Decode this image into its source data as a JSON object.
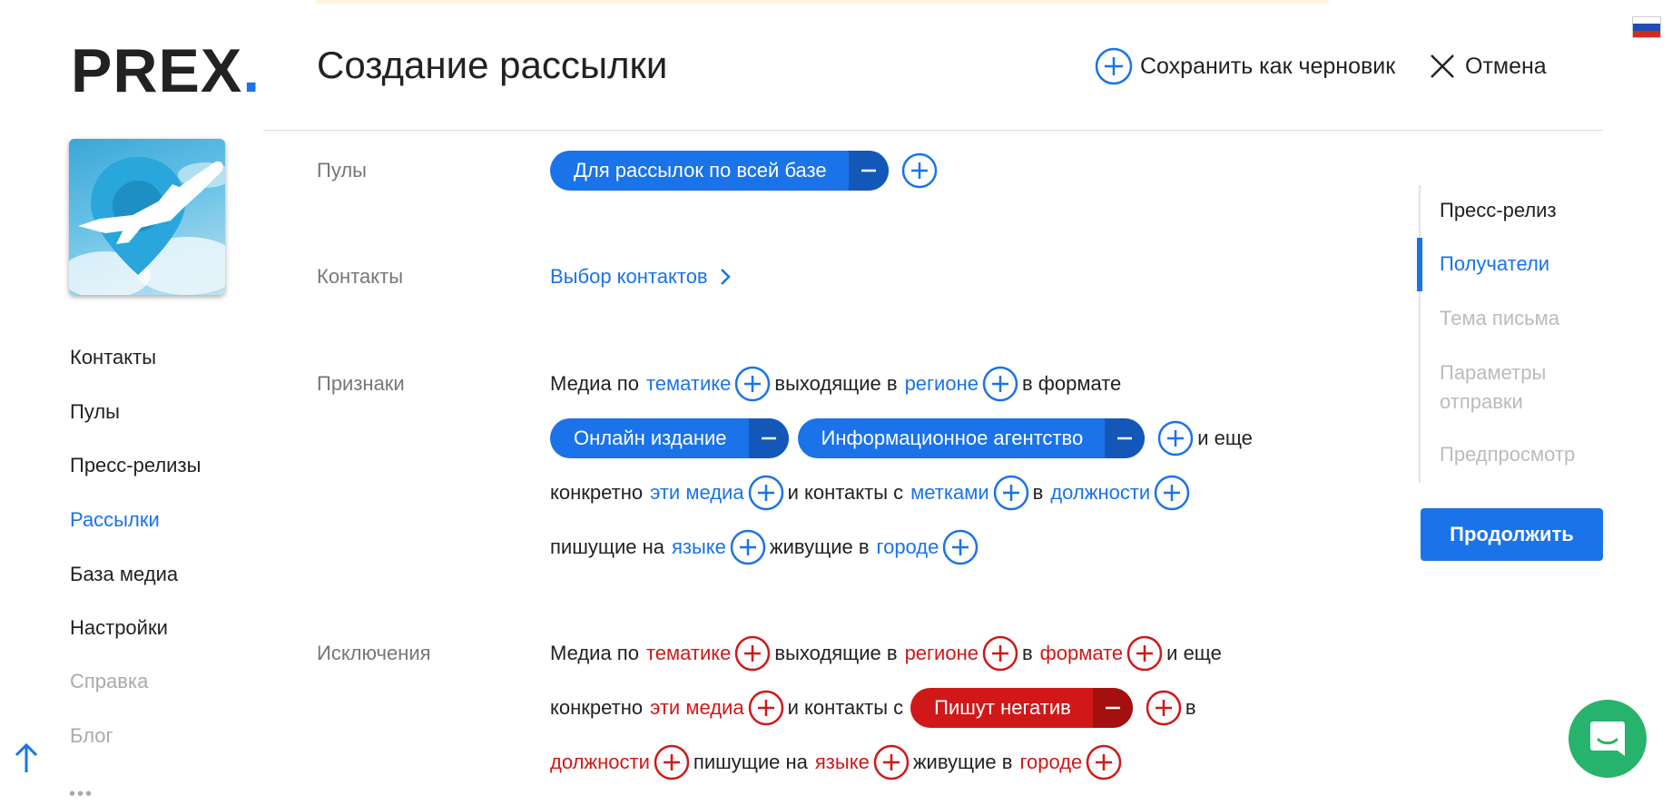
{
  "logo": {
    "text": "PREX",
    "dot": "."
  },
  "sidebar": {
    "items": [
      {
        "label": "Контакты"
      },
      {
        "label": "Пулы"
      },
      {
        "label": "Пресс-релизы"
      },
      {
        "label": "Рассылки"
      },
      {
        "label": "База медиа"
      },
      {
        "label": "Настройки"
      },
      {
        "label": "Справка"
      },
      {
        "label": "Блог"
      }
    ],
    "more": "•••"
  },
  "header": {
    "title": "Создание рассылки",
    "save_draft": "Сохранить как черновик",
    "cancel": "Отмена"
  },
  "form": {
    "pools": {
      "label": "Пулы",
      "chip": "Для рассылок по всей базе"
    },
    "contacts": {
      "label": "Контакты",
      "link": "Выбор контактов"
    },
    "features": {
      "label": "Признаки",
      "media_by": "Медиа по",
      "topic": "тематике",
      "published_in": "выходящие в",
      "region": "регионе",
      "in_format": "в формате",
      "chip_online": "Онлайн издание",
      "chip_agency": "Информационное агентство",
      "and_more": "и еще",
      "specifically": "конкретно",
      "these_media": "эти медиа",
      "and_contacts_with": "и контакты с",
      "tags": "метками",
      "in": "в",
      "positions": "должности",
      "writing_in": "пишущие на",
      "language": "языке",
      "living_in": "живущие в",
      "city": "городе"
    },
    "exclusions": {
      "label": "Исключения",
      "media_by": "Медиа по",
      "topic": "тематике",
      "published_in": "выходящие в",
      "region": "регионе",
      "in": "в",
      "format": "формате",
      "and_more": "и еще",
      "specifically": "конкретно",
      "these_media": "эти медиа",
      "and_contacts_with": "и контакты с",
      "chip_negative": "Пишут негатив",
      "in2": "в",
      "positions": "должности",
      "writing_in": "пишущие на",
      "language": "языке",
      "living_in": "живущие в",
      "city": "городе"
    }
  },
  "steps": {
    "items": [
      {
        "label": "Пресс-релиз",
        "state": "done"
      },
      {
        "label": "Получатели",
        "state": "active"
      },
      {
        "label": "Тема письма",
        "state": "pending"
      },
      {
        "label": "Параметры отправки",
        "state": "pending"
      },
      {
        "label": "Предпросмотр",
        "state": "pending"
      }
    ],
    "continue": "Продолжить"
  },
  "colors": {
    "accent": "#1a73e8",
    "danger": "#d01818",
    "chat": "#27b36b"
  },
  "icons": [
    "plus-circle-icon",
    "close-icon",
    "chevron-right-icon",
    "minus-icon",
    "arrow-up-icon",
    "chat-icon",
    "russian-flag-icon"
  ]
}
